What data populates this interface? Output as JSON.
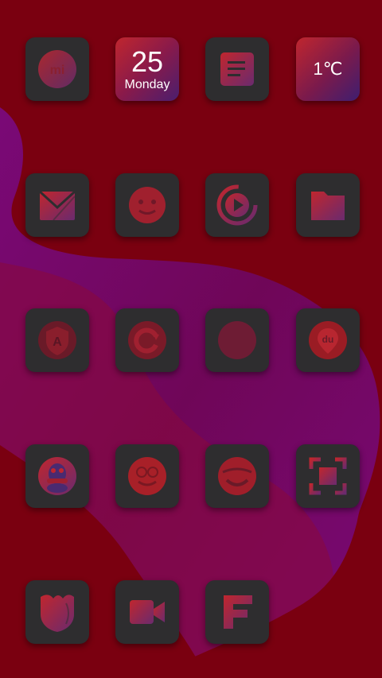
{
  "colors": {
    "wallpaper_red": "#7a0010",
    "wallpaper_purple": "#7a0a82",
    "tile_bg": "#2e2d2f",
    "accent_red": "#c0262e",
    "accent_purple": "#4a1e6e"
  },
  "calendar_widget": {
    "day_number": "25",
    "weekday": "Monday"
  },
  "weather_widget": {
    "temperature": "1℃"
  },
  "apps": [
    {
      "icon": "mi-icon"
    },
    {
      "icon": "calendar-widget"
    },
    {
      "icon": "notes-icon"
    },
    {
      "icon": "weather-widget"
    },
    {
      "icon": "mail-icon"
    },
    {
      "icon": "emoji-face-icon"
    },
    {
      "icon": "video-player-icon"
    },
    {
      "icon": "folder-icon"
    },
    {
      "icon": "security-shield-icon"
    },
    {
      "icon": "refresh-icon"
    },
    {
      "icon": "circle-app-icon"
    },
    {
      "icon": "map-pin-icon"
    },
    {
      "icon": "qq-penguin-icon"
    },
    {
      "icon": "chat-face-icon"
    },
    {
      "icon": "smile-ball-icon"
    },
    {
      "icon": "screenshot-frame-icon"
    },
    {
      "icon": "browser-shield-icon"
    },
    {
      "icon": "video-camera-icon"
    },
    {
      "icon": "f-letter-icon"
    }
  ]
}
